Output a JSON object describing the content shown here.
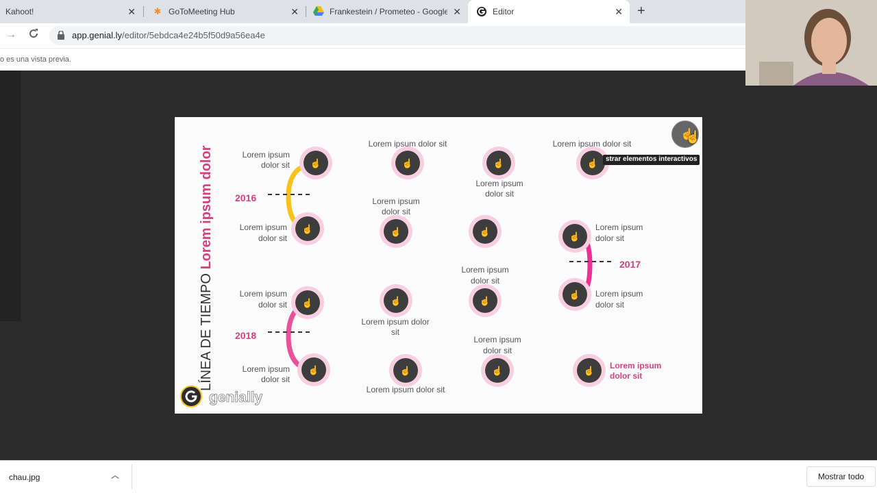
{
  "browser": {
    "tabs": [
      {
        "title": "Kahoot!",
        "icon": "kahoot-icon"
      },
      {
        "title": "GoToMeeting Hub",
        "icon": "gotomeeting-icon"
      },
      {
        "title": "Frankestein / Prometeo - Google",
        "icon": "google-drive-icon"
      },
      {
        "title": "Editor",
        "icon": "genially-icon",
        "active": true
      }
    ],
    "url_host": "app.genial.ly",
    "url_path": "/editor/5ebdca4e24b5f50d9a56ea4e",
    "infobar_text": "o es una vista previa."
  },
  "slide": {
    "vertical_title_part1": "LÍNEA DE TIEMPO ",
    "vertical_title_part2": "Lorem ipsum dolor",
    "years": [
      "2016",
      "2017",
      "2018"
    ],
    "labels": {
      "r1a": [
        "Lorem ipsum",
        "dolor sit"
      ],
      "r1b": "Lorem ipsum dolor sit",
      "r1c": [
        "Lorem ipsum",
        "dolor sit"
      ],
      "r1d": "Lorem ipsum dolor sit",
      "r2a": [
        "Lorem ipsum",
        "dolor sit"
      ],
      "r2b": [
        "Lorem ipsum",
        "dolor sit"
      ],
      "r2d": [
        "Lorem ipsum",
        "dolor sit"
      ],
      "r3a": [
        "Lorem ipsum",
        "dolor sit"
      ],
      "r3b": [
        "Lorem ipsum dolor",
        "sit"
      ],
      "r3c": [
        "Lorem ipsum",
        "dolor sit"
      ],
      "r3d": [
        "Lorem ipsum",
        "dolor sit"
      ],
      "r4a": [
        "Lorem ipsum",
        "dolor sit"
      ],
      "r4b": "Lorem ipsum dolor sit",
      "r4c": [
        "Lorem ipsum",
        "dolor sit"
      ],
      "r4d": [
        "Lorem ipsum",
        "dolor sit"
      ]
    },
    "brand": "genially",
    "tooltip": "strar elementos interactivos",
    "accent_color": "#d6407f"
  },
  "downloads": {
    "filename": "chau.jpg",
    "show_all_label": "Mostrar todo"
  }
}
